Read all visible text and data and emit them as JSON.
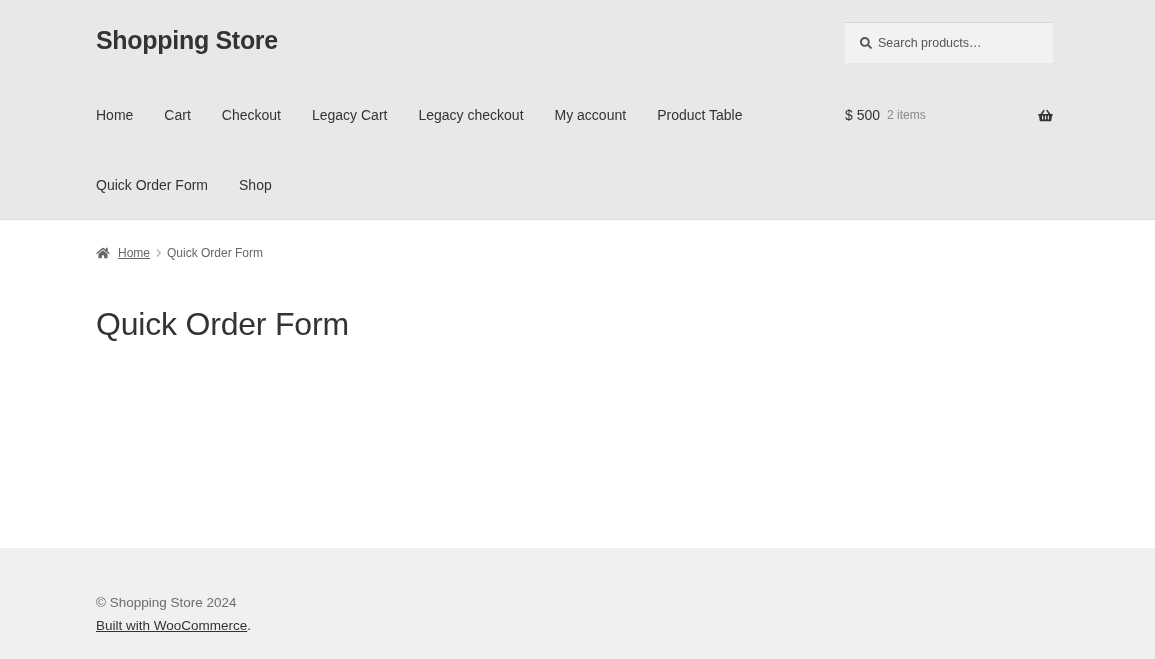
{
  "site_title": "Shopping Store",
  "search": {
    "placeholder": "Search products…"
  },
  "nav": {
    "items": [
      {
        "label": "Home"
      },
      {
        "label": "Cart"
      },
      {
        "label": "Checkout"
      },
      {
        "label": "Legacy Cart"
      },
      {
        "label": "Legacy checkout"
      },
      {
        "label": "My account"
      },
      {
        "label": "Product Table"
      },
      {
        "label": "Quick Order Form"
      },
      {
        "label": "Shop"
      }
    ]
  },
  "cart": {
    "total": "$ 500",
    "count": "2 items"
  },
  "breadcrumb": [
    {
      "label": "Home",
      "kind": "link"
    },
    {
      "label": "Quick Order Form",
      "kind": "current"
    }
  ],
  "page_title": "Quick Order Form",
  "footer": {
    "copyright": "© Shopping Store 2024",
    "credit": {
      "link": "Built with WooCommerce",
      "suffix": "."
    }
  }
}
